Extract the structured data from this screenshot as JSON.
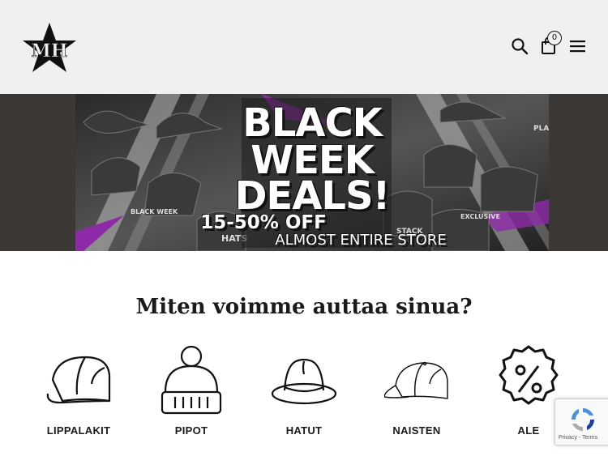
{
  "header": {
    "logo_alt": "MH",
    "cart_count": "0"
  },
  "banner": {
    "line1": "BLACK",
    "line2": "WEEK",
    "line3": "DEALS!",
    "line4": "15-50% OFF",
    "line5": "ALMOST ENTIRE STORE",
    "tags": [
      "BLACK WEEK",
      "HATS",
      "STACK",
      "EXCLUSIVE",
      "PLA"
    ]
  },
  "section": {
    "title": "Miten voimme auttaa sinua?",
    "categories": [
      {
        "label": "LIPPALAKIT",
        "icon": "cap-icon"
      },
      {
        "label": "PIPOT",
        "icon": "beanie-icon"
      },
      {
        "label": "HATUT",
        "icon": "fedora-icon"
      },
      {
        "label": "NAISTEN",
        "icon": "womens-cap-icon"
      },
      {
        "label": "ALE",
        "icon": "percent-badge-icon"
      }
    ]
  },
  "recaptcha": {
    "links": "Privacy - Terms"
  }
}
